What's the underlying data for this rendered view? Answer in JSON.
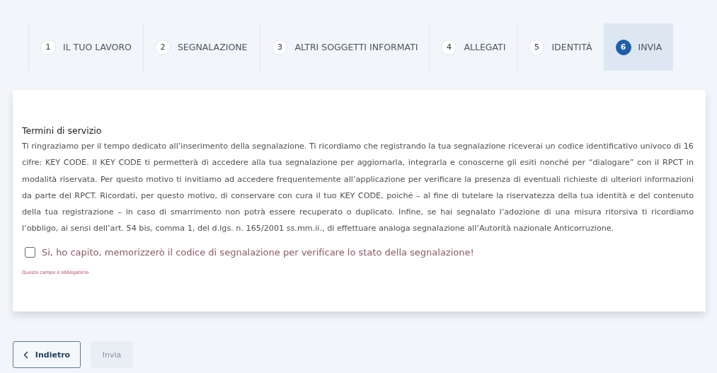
{
  "steps": [
    {
      "number": "1",
      "label": "IL TUO LAVORO",
      "selected": false
    },
    {
      "number": "2",
      "label": "SEGNALAZIONE",
      "selected": false
    },
    {
      "number": "3",
      "label": "ALTRI SOGGETTI INFORMATI",
      "selected": false
    },
    {
      "number": "4",
      "label": "ALLEGATI",
      "selected": false
    },
    {
      "number": "5",
      "label": "IDENTITÀ",
      "selected": false
    },
    {
      "number": "6",
      "label": "INVIA",
      "selected": true
    }
  ],
  "terms": {
    "title": "Termini di servizio",
    "text": "Ti ringraziamo per il tempo dedicato all’inserimento della segnalazione. Ti ricordiamo che registrando la tua segnalazione riceverai un codice identificativo univoco di 16 cifre: KEY CODE. Il KEY CODE ti permetterà di accedere alla tua segnalazione per aggiornarla, integrarla e conoscerne gli esiti nonché per “dialogare” con il RPCT in modalità riservata. Per questo motivo ti invitiamo ad accedere frequentemente all’applicazione per verificare la presenza di eventuali richieste di ulteriori informazioni da parte del RPCT. Ricordati, per questo motivo, di conservare con cura il tuo KEY CODE, poiché – al fine di tutelare la riservatezza della tua identità e del contenuto della tua registrazione – in caso di smarrimento non potrà essere recuperato o duplicato. Infine, se hai segnalato l’adozione di una misura ritorsiva ti ricordiamo l’obbligo, ai sensi dell’art. 54 bis, comma 1, del d.lgs. n. 165/2001 ss.mm.ii., di effettuare analoga segnalazione all’Autorità nazionale Anticorruzione.",
    "checkbox": {
      "label": "Si, ho capito, memorizzerò il codice di segnalazione per verificare lo stato della segnalazione!",
      "checked": false
    },
    "hint": "Questo campo è obbligatorio"
  },
  "buttons": [
    {
      "kind": "back",
      "label": "Indietro",
      "disabled": false
    },
    {
      "kind": "submit",
      "label": "Invia",
      "disabled": true
    }
  ]
}
